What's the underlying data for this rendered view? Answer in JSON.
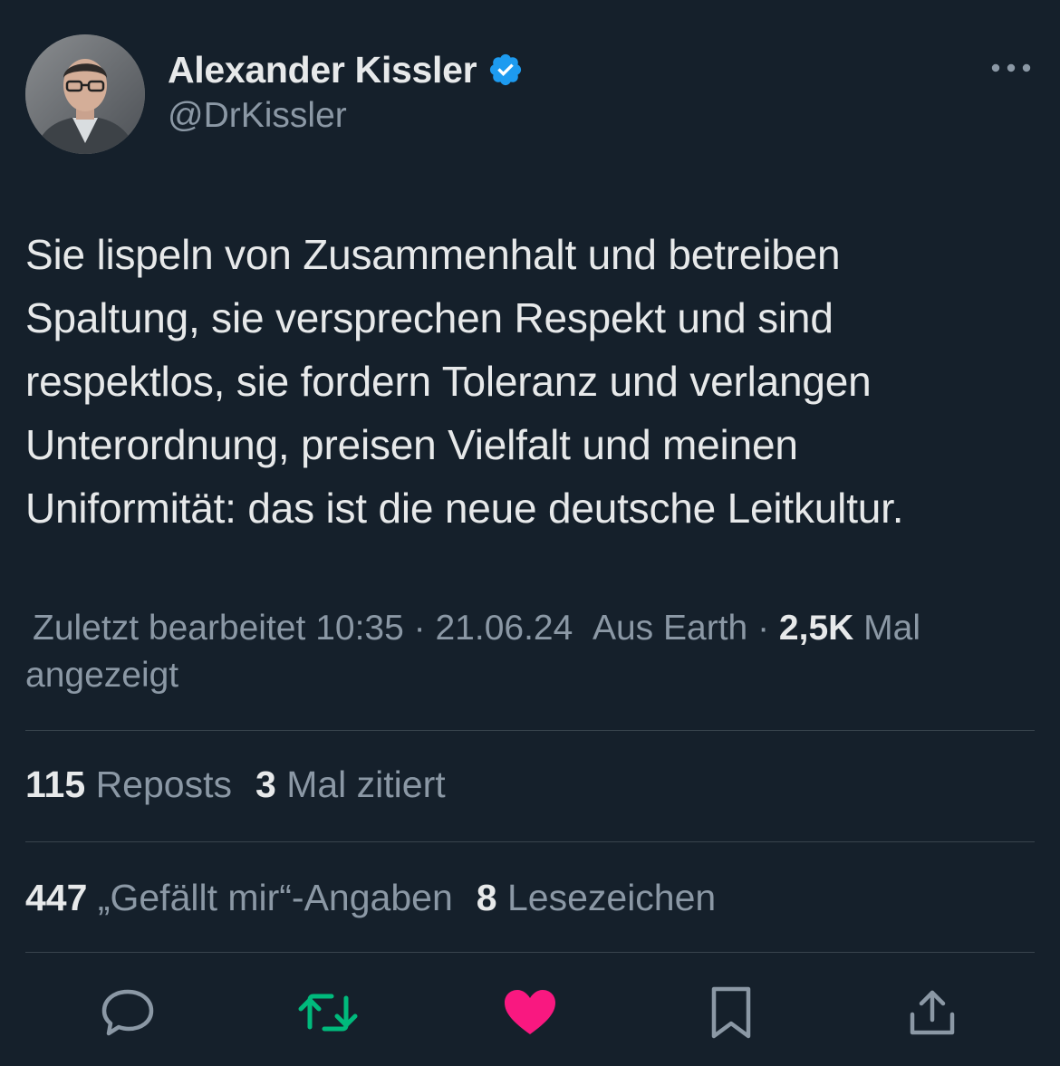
{
  "author": {
    "display_name": "Alexander Kissler",
    "handle": "@DrKissler",
    "verified": true,
    "verified_color": "#1d9bf0"
  },
  "tweet": {
    "text": "Sie lispeln von Zusammenhalt und betreiben\nSpaltung, sie versprechen Respekt und sind\nrespektlos, sie fordern Toleranz und verlangen\nUnterordnung, preisen Vielfalt und meinen\nUniformität: das ist die neue deutsche Leitkultur."
  },
  "meta": {
    "edited_label": "Zuletzt bearbeitet",
    "time": "10:35",
    "date": "21.06.24",
    "location": "Aus Earth",
    "views_count": "2,5K",
    "views_label": "Mal angezeigt",
    "separator": "·"
  },
  "stats": {
    "reposts_count": "115",
    "reposts_label": "Reposts",
    "quotes_count": "3",
    "quotes_label": "Mal zitiert",
    "likes_count": "447",
    "likes_label": "„Gefällt mir“-Angaben",
    "bookmarks_count": "8",
    "bookmarks_label": "Lesezeichen"
  },
  "actions": {
    "icons": [
      "reply-icon",
      "repost-icon",
      "like-icon",
      "bookmark-icon",
      "share-icon"
    ],
    "repost_color": "#00ba7c",
    "like_color": "#f91880",
    "icon_color": "#8b98a5"
  },
  "colors": {
    "background": "#15202b",
    "text": "#e7e9ea",
    "muted": "#8b98a5",
    "divider": "#38444d"
  }
}
